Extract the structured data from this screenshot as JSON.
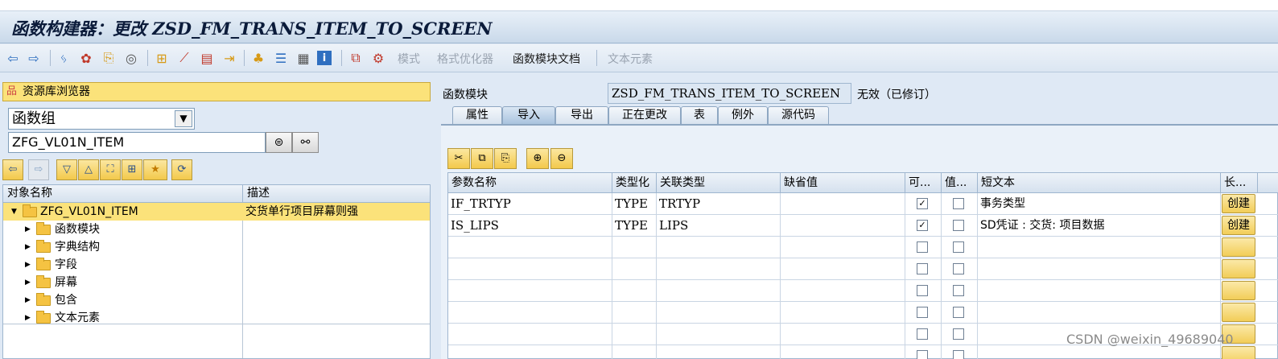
{
  "window_title": "函数构建器：更改 ZSD_FM_TRANS_ITEM_TO_SCREEN",
  "toolbar": {
    "icons": [
      "back-icon",
      "forward-icon",
      "check-icon",
      "activate-icon",
      "where-used-icon",
      "display-object-icon",
      "hierarchy-icon",
      "pattern-icon",
      "insert-icon",
      "move-icon",
      "navigation-icon",
      "tree-icon",
      "layout-icon",
      "info-icon",
      "test-icon",
      "debug-icon"
    ],
    "text_buttons": {
      "mode": "模式",
      "pretty_printer": "格式优化器",
      "fm_docs": "函数模块文档",
      "text_elements": "文本元素"
    }
  },
  "repository": {
    "title": "资源库浏览器",
    "object_type": "函数组",
    "object_name": "ZFG_VL01N_ITEM",
    "columns": {
      "name": "对象名称",
      "desc": "描述"
    },
    "root": {
      "name": "ZFG_VL01N_ITEM",
      "desc": "交货单行项目屏幕则强"
    },
    "children": [
      "函数模块",
      "字典结构",
      "字段",
      "屏幕",
      "包含",
      "文本元素"
    ]
  },
  "function_module": {
    "label": "函数模块",
    "name": "ZSD_FM_TRANS_ITEM_TO_SCREEN",
    "status": "无效（已修订）"
  },
  "tabs": [
    "属性",
    "导入",
    "导出",
    "正在更改",
    "表",
    "例外",
    "源代码"
  ],
  "active_tab": "导入",
  "grid": {
    "headers": [
      "参数名称",
      "类型化",
      "关联类型",
      "缺省值",
      "可...",
      "值...",
      "短文本",
      "长..."
    ],
    "rows": [
      {
        "param": "IF_TRTYP",
        "typing": "TYPE",
        "assoc": "TRTYP",
        "default": "",
        "optional": true,
        "pass_value": false,
        "short_text": "事务类型",
        "long": "创建"
      },
      {
        "param": "IS_LIPS",
        "typing": "TYPE",
        "assoc": "LIPS",
        "default": "",
        "optional": true,
        "pass_value": false,
        "short_text": "SD凭证 : 交货: 项目数据",
        "long": "创建"
      },
      {
        "param": "",
        "typing": "",
        "assoc": "",
        "default": "",
        "optional": false,
        "pass_value": false,
        "short_text": "",
        "long": ""
      },
      {
        "param": "",
        "typing": "",
        "assoc": "",
        "default": "",
        "optional": false,
        "pass_value": false,
        "short_text": "",
        "long": ""
      },
      {
        "param": "",
        "typing": "",
        "assoc": "",
        "default": "",
        "optional": false,
        "pass_value": false,
        "short_text": "",
        "long": ""
      },
      {
        "param": "",
        "typing": "",
        "assoc": "",
        "default": "",
        "optional": false,
        "pass_value": false,
        "short_text": "",
        "long": ""
      },
      {
        "param": "",
        "typing": "",
        "assoc": "",
        "default": "",
        "optional": false,
        "pass_value": false,
        "short_text": "",
        "long": ""
      },
      {
        "param": "",
        "typing": "",
        "assoc": "",
        "default": "",
        "optional": false,
        "pass_value": false,
        "short_text": "",
        "long": ""
      }
    ]
  },
  "watermark": "CSDN @weixin_49689040",
  "colors": {
    "accent_yellow": "#fbe27a",
    "toolbar_blue": "#dbe6f2",
    "grid_border": "#9fb6cf"
  }
}
